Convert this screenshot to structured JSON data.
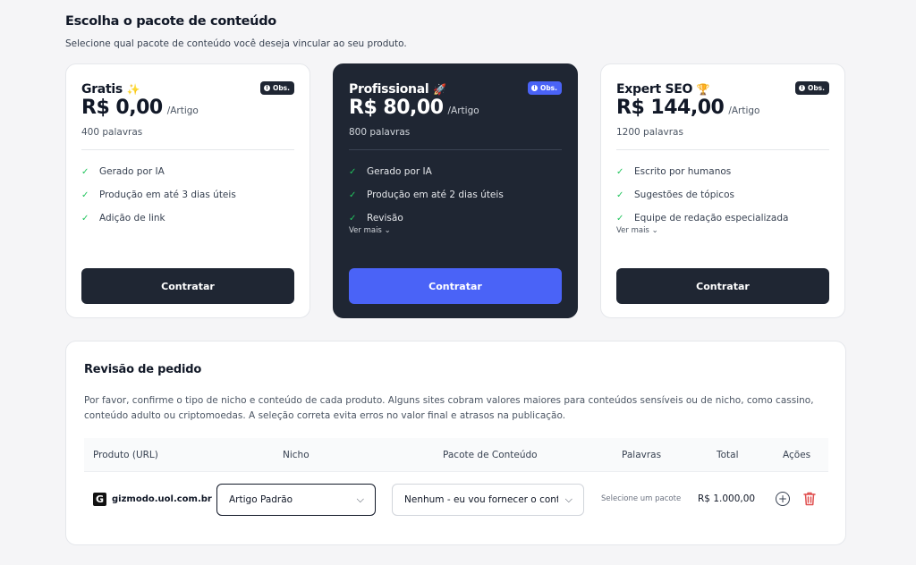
{
  "header": {
    "title": "Escolha o pacote de conteúdo",
    "subtitle": "Selecione qual pacote de conteúdo você deseja vincular ao seu produto."
  },
  "plans": [
    {
      "name": "Gratis",
      "emoji": "✨",
      "badge": "Obs.",
      "price": "R$ 0,00",
      "per": "/Artigo",
      "words": "400 palavras",
      "features": [
        "Gerado por IA",
        "Produção em até 3 dias úteis",
        "Adição de link"
      ],
      "see_more": "",
      "button": "Contratar"
    },
    {
      "name": "Profissional",
      "emoji": "🚀",
      "badge": "Obs.",
      "price": "R$ 80,00",
      "per": "/Artigo",
      "words": "800 palavras",
      "features": [
        "Gerado por IA",
        "Produção em até 2 dias úteis",
        "Revisão"
      ],
      "see_more": "Ver mais",
      "button": "Contratar"
    },
    {
      "name": "Expert SEO",
      "emoji": "🏆",
      "badge": "Obs.",
      "price": "R$ 144,00",
      "per": "/Artigo",
      "words": "1200 palavras",
      "features": [
        "Escrito por humanos",
        "Sugestões de tópicos",
        "Equipe de redação especializada"
      ],
      "see_more": "Ver mais",
      "button": "Contratar"
    }
  ],
  "review": {
    "title": "Revisão de pedido",
    "description": "Por favor, confirme o tipo de nicho e conteúdo de cada produto. Alguns sites cobram valores maiores para conteúdos sensíveis ou de nicho, como cassino, conteúdo adulto ou criptomoedas. A seleção correta evita erros no valor final e atrasos na publicação.",
    "columns": {
      "product": "Produto (URL)",
      "niche": "Nicho",
      "package": "Pacote de Conteúdo",
      "words": "Palavras",
      "total": "Total",
      "actions": "Ações"
    },
    "rows": [
      {
        "logo": "G",
        "product": "gizmodo.uol.com.br",
        "niche": "Artigo Padrão",
        "package": "Nenhum - eu vou fornecer o conteúdo",
        "words": "Selecione um pacote",
        "total": "R$ 1.000,00"
      }
    ]
  },
  "colors": {
    "dark": "#1f2633",
    "accent": "#4a63f7",
    "check": "#22c55e",
    "delete": "#e04f4f"
  }
}
